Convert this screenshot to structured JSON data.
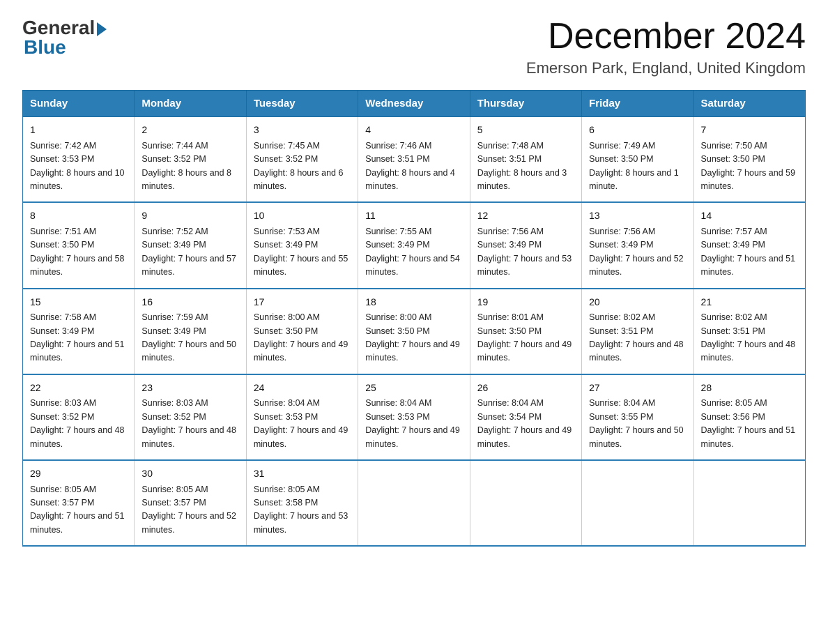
{
  "logo": {
    "general_text": "General",
    "blue_text": "Blue"
  },
  "title": "December 2024",
  "subtitle": "Emerson Park, England, United Kingdom",
  "headers": [
    "Sunday",
    "Monday",
    "Tuesday",
    "Wednesday",
    "Thursday",
    "Friday",
    "Saturday"
  ],
  "weeks": [
    [
      {
        "day": "1",
        "sunrise": "7:42 AM",
        "sunset": "3:53 PM",
        "daylight": "8 hours and 10 minutes."
      },
      {
        "day": "2",
        "sunrise": "7:44 AM",
        "sunset": "3:52 PM",
        "daylight": "8 hours and 8 minutes."
      },
      {
        "day": "3",
        "sunrise": "7:45 AM",
        "sunset": "3:52 PM",
        "daylight": "8 hours and 6 minutes."
      },
      {
        "day": "4",
        "sunrise": "7:46 AM",
        "sunset": "3:51 PM",
        "daylight": "8 hours and 4 minutes."
      },
      {
        "day": "5",
        "sunrise": "7:48 AM",
        "sunset": "3:51 PM",
        "daylight": "8 hours and 3 minutes."
      },
      {
        "day": "6",
        "sunrise": "7:49 AM",
        "sunset": "3:50 PM",
        "daylight": "8 hours and 1 minute."
      },
      {
        "day": "7",
        "sunrise": "7:50 AM",
        "sunset": "3:50 PM",
        "daylight": "7 hours and 59 minutes."
      }
    ],
    [
      {
        "day": "8",
        "sunrise": "7:51 AM",
        "sunset": "3:50 PM",
        "daylight": "7 hours and 58 minutes."
      },
      {
        "day": "9",
        "sunrise": "7:52 AM",
        "sunset": "3:49 PM",
        "daylight": "7 hours and 57 minutes."
      },
      {
        "day": "10",
        "sunrise": "7:53 AM",
        "sunset": "3:49 PM",
        "daylight": "7 hours and 55 minutes."
      },
      {
        "day": "11",
        "sunrise": "7:55 AM",
        "sunset": "3:49 PM",
        "daylight": "7 hours and 54 minutes."
      },
      {
        "day": "12",
        "sunrise": "7:56 AM",
        "sunset": "3:49 PM",
        "daylight": "7 hours and 53 minutes."
      },
      {
        "day": "13",
        "sunrise": "7:56 AM",
        "sunset": "3:49 PM",
        "daylight": "7 hours and 52 minutes."
      },
      {
        "day": "14",
        "sunrise": "7:57 AM",
        "sunset": "3:49 PM",
        "daylight": "7 hours and 51 minutes."
      }
    ],
    [
      {
        "day": "15",
        "sunrise": "7:58 AM",
        "sunset": "3:49 PM",
        "daylight": "7 hours and 51 minutes."
      },
      {
        "day": "16",
        "sunrise": "7:59 AM",
        "sunset": "3:49 PM",
        "daylight": "7 hours and 50 minutes."
      },
      {
        "day": "17",
        "sunrise": "8:00 AM",
        "sunset": "3:50 PM",
        "daylight": "7 hours and 49 minutes."
      },
      {
        "day": "18",
        "sunrise": "8:00 AM",
        "sunset": "3:50 PM",
        "daylight": "7 hours and 49 minutes."
      },
      {
        "day": "19",
        "sunrise": "8:01 AM",
        "sunset": "3:50 PM",
        "daylight": "7 hours and 49 minutes."
      },
      {
        "day": "20",
        "sunrise": "8:02 AM",
        "sunset": "3:51 PM",
        "daylight": "7 hours and 48 minutes."
      },
      {
        "day": "21",
        "sunrise": "8:02 AM",
        "sunset": "3:51 PM",
        "daylight": "7 hours and 48 minutes."
      }
    ],
    [
      {
        "day": "22",
        "sunrise": "8:03 AM",
        "sunset": "3:52 PM",
        "daylight": "7 hours and 48 minutes."
      },
      {
        "day": "23",
        "sunrise": "8:03 AM",
        "sunset": "3:52 PM",
        "daylight": "7 hours and 48 minutes."
      },
      {
        "day": "24",
        "sunrise": "8:04 AM",
        "sunset": "3:53 PM",
        "daylight": "7 hours and 49 minutes."
      },
      {
        "day": "25",
        "sunrise": "8:04 AM",
        "sunset": "3:53 PM",
        "daylight": "7 hours and 49 minutes."
      },
      {
        "day": "26",
        "sunrise": "8:04 AM",
        "sunset": "3:54 PM",
        "daylight": "7 hours and 49 minutes."
      },
      {
        "day": "27",
        "sunrise": "8:04 AM",
        "sunset": "3:55 PM",
        "daylight": "7 hours and 50 minutes."
      },
      {
        "day": "28",
        "sunrise": "8:05 AM",
        "sunset": "3:56 PM",
        "daylight": "7 hours and 51 minutes."
      }
    ],
    [
      {
        "day": "29",
        "sunrise": "8:05 AM",
        "sunset": "3:57 PM",
        "daylight": "7 hours and 51 minutes."
      },
      {
        "day": "30",
        "sunrise": "8:05 AM",
        "sunset": "3:57 PM",
        "daylight": "7 hours and 52 minutes."
      },
      {
        "day": "31",
        "sunrise": "8:05 AM",
        "sunset": "3:58 PM",
        "daylight": "7 hours and 53 minutes."
      },
      null,
      null,
      null,
      null
    ]
  ]
}
